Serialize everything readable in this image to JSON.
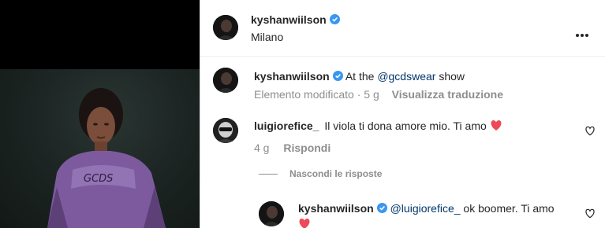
{
  "post": {
    "author": "kyshanwiilson",
    "location": "Milano",
    "more_icon": "more-horizontal-icon"
  },
  "caption": {
    "author": "kyshanwiilson",
    "text_prefix": "At the",
    "mention": "@gcdswear",
    "text_suffix": "show",
    "edited_label": "Elemento modificato",
    "age": "5 g",
    "translate_label": "Visualizza traduzione"
  },
  "comment": {
    "author": "luigiorefice_",
    "text": "Il viola ti dona amore mio. Ti amo",
    "emoji": "red-heart-emoji",
    "age": "4 g",
    "reply_label": "Rispondi"
  },
  "replies_toggle": "Nascondi le risposte",
  "reply": {
    "author": "kyshanwiilson",
    "mention": "@luigiorefice_",
    "text": "ok boomer. Ti amo",
    "emoji": "red-heart-emoji"
  },
  "colors": {
    "verified": "#3897f0",
    "mention": "#00376b",
    "muted": "#8e8e8e",
    "heart_emoji": "#ed4956",
    "jacket": "#7d5a9e"
  }
}
